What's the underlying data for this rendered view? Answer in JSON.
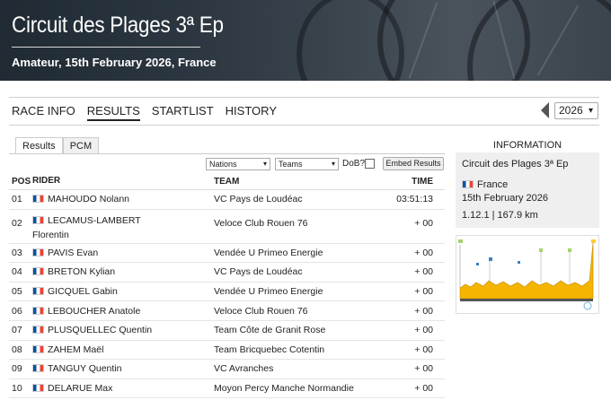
{
  "banner": {
    "title": "Circuit des Plages 3ª Ep",
    "subtitle": "Amateur, 15th February 2026, France"
  },
  "nav": {
    "items": [
      "RACE INFO",
      "RESULTS",
      "STARTLIST",
      "HISTORY"
    ],
    "active": "RESULTS",
    "year": "2026"
  },
  "tabs": [
    "Results",
    "PCM"
  ],
  "filters": {
    "nations": "Nations",
    "teams": "Teams",
    "dob_label": "DoB?",
    "embed": "Embed Results"
  },
  "table": {
    "headers": {
      "pos": "POS",
      "rider": "RIDER",
      "team": "TEAM",
      "time": "TIME"
    },
    "rows": [
      {
        "pos": "01",
        "rider": "MAHOUDO Nolann",
        "rider2": "",
        "team": "VC Pays de Loudéac",
        "time": "03:51:13"
      },
      {
        "pos": "02",
        "rider": "LECAMUS-LAMBERT",
        "rider2": "Florentin",
        "team": "Veloce Club Rouen 76",
        "time": "+ 00"
      },
      {
        "pos": "03",
        "rider": "PAVIS Evan",
        "rider2": "",
        "team": "Vendée U Primeo Energie",
        "time": "+ 00"
      },
      {
        "pos": "04",
        "rider": "BRETON Kylian",
        "rider2": "",
        "team": "VC Pays de Loudéac",
        "time": "+ 00"
      },
      {
        "pos": "05",
        "rider": "GICQUEL Gabin",
        "rider2": "",
        "team": "Vendée U Primeo Energie",
        "time": "+ 00"
      },
      {
        "pos": "06",
        "rider": "LEBOUCHER Anatole",
        "rider2": "",
        "team": "Veloce Club Rouen 76",
        "time": "+ 00"
      },
      {
        "pos": "07",
        "rider": "PLUSQUELLEC Quentin",
        "rider2": "",
        "team": "Team Côte de Granit Rose",
        "time": "+ 00"
      },
      {
        "pos": "08",
        "rider": "ZAHEM Maël",
        "rider2": "",
        "team": "Team Bricquebec Cotentin",
        "time": "+ 00"
      },
      {
        "pos": "09",
        "rider": "TANGUY Quentin",
        "rider2": "",
        "team": "VC Avranches",
        "time": "+ 00"
      },
      {
        "pos": "10",
        "rider": "DELARUE Max",
        "rider2": "",
        "team": "Moyon Percy Manche Normandie",
        "time": "+ 00"
      }
    ]
  },
  "info": {
    "heading": "INFORMATION",
    "race": "Circuit des Plages 3ª Ep",
    "country": "France",
    "date": "15th February 2026",
    "classification": "1.12.1 | 167.9 km"
  },
  "icons": {
    "flag": "france-flag-icon",
    "prev": "triangle-left-icon"
  },
  "colors": {
    "flag_blue": "#0055a4",
    "flag_red": "#ef4135",
    "profile_fill": "#f4b400"
  }
}
